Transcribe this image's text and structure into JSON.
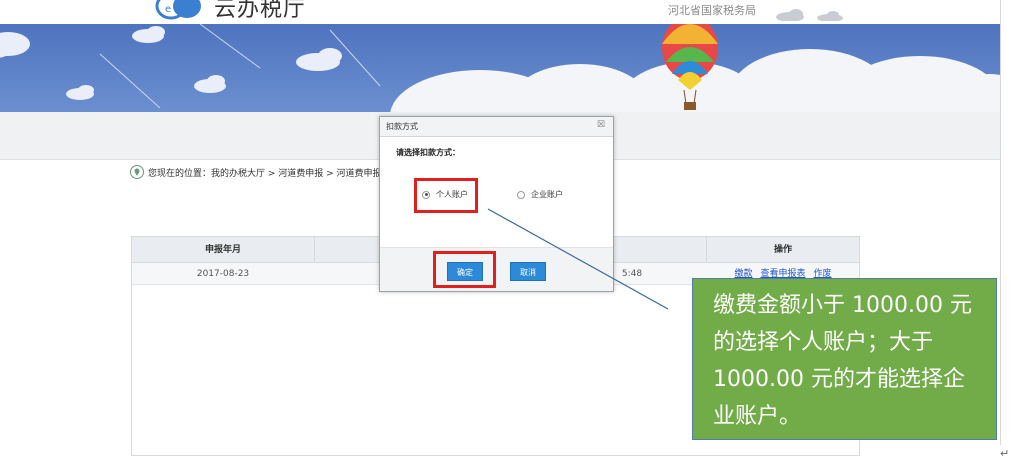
{
  "header": {
    "site_title": "云办税厅",
    "bureau": "河北省国家税务局"
  },
  "breadcrumb": {
    "text": "您现在的位置：我的办税大厅 > 河道费申报 > 河道费申报"
  },
  "table": {
    "columns": [
      "申报年月",
      "",
      "",
      "操作"
    ],
    "rows": [
      {
        "date": "2017-08-23",
        "time_fragment": "5:48",
        "ops": [
          "缴款",
          "查看申报表",
          "作废"
        ]
      }
    ]
  },
  "dialog": {
    "title": "扣款方式",
    "close_glyph": "☒",
    "prompt": "请选择扣款方式：",
    "options": [
      {
        "label": "个人账户",
        "checked": true
      },
      {
        "label": "企业账户",
        "checked": false
      }
    ],
    "confirm_label": "确定",
    "cancel_label": "取消"
  },
  "callout": {
    "text": "缴费金额小于 1000.00 元的选择个人账户；大于 1000.00 元的才能选择企业账户。"
  },
  "colors": {
    "banner": "#5a7fc6",
    "highlight": "#e01f1f",
    "callout": "#71ac49",
    "button": "#2c8ad8"
  }
}
